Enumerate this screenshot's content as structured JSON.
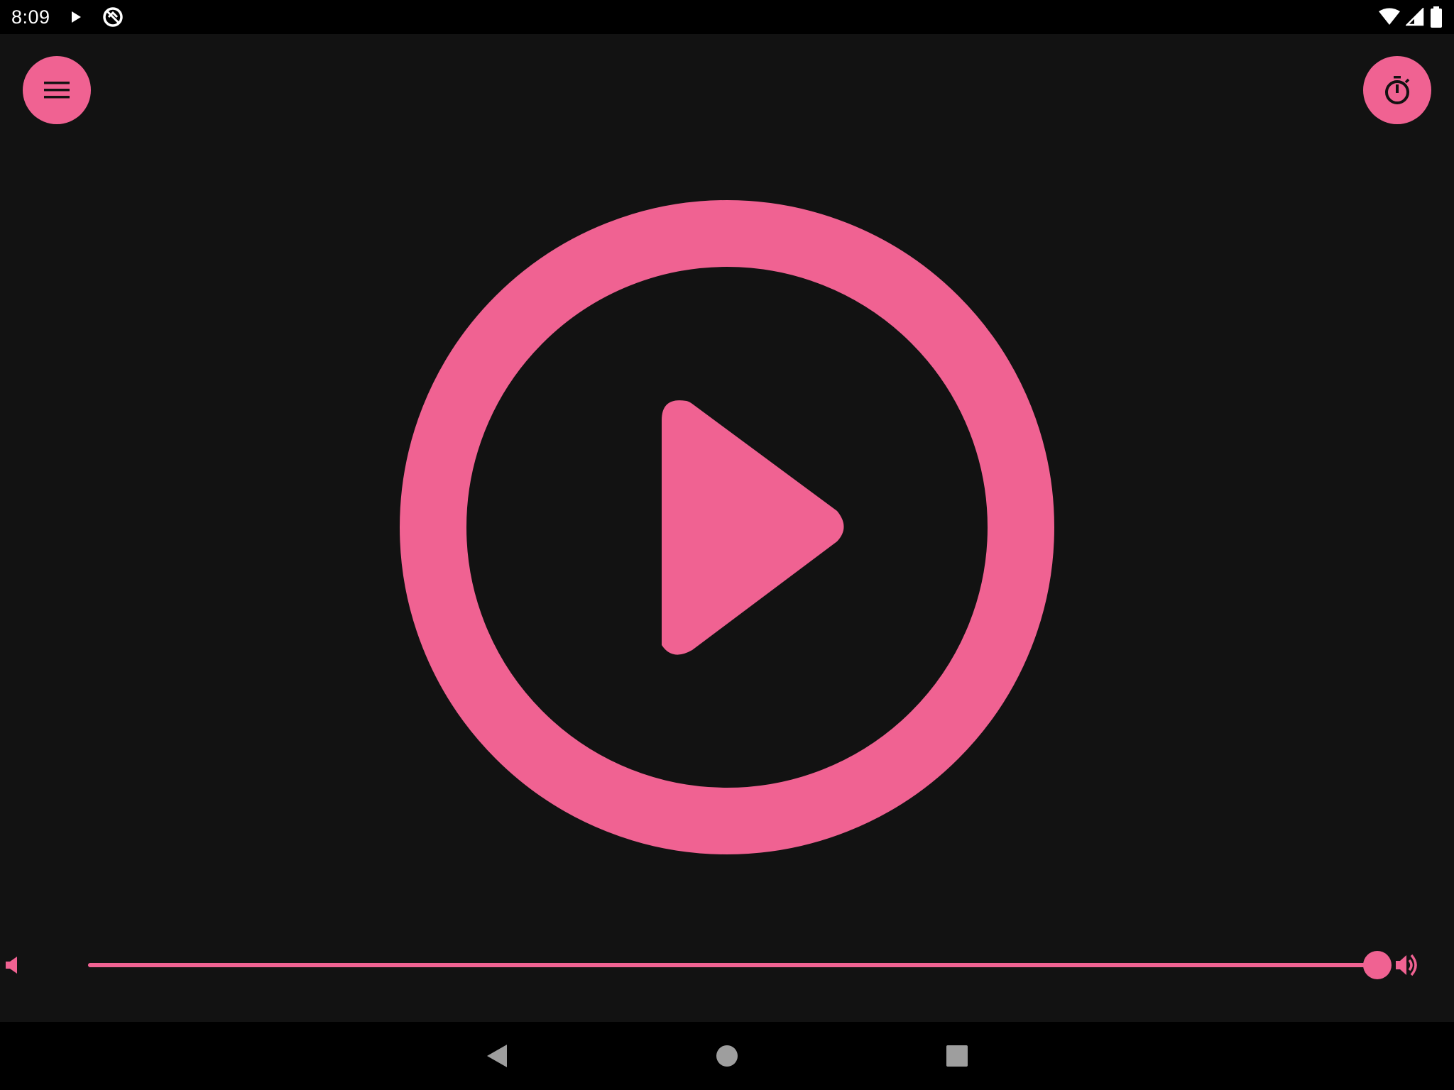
{
  "colors": {
    "accent": "#f06292",
    "background": "#121212",
    "system_bar": "#000000",
    "icon_dark": "#121212",
    "nav_icon": "#9e9e9e"
  },
  "status_bar": {
    "time": "8:09",
    "icons": [
      "play-notification-icon",
      "location-off-icon",
      "wifi-icon",
      "signal-icon",
      "battery-icon"
    ]
  },
  "toolbar": {
    "menu_icon": "menu-icon",
    "timer_icon": "timer-icon"
  },
  "player": {
    "state": "paused",
    "main_icon": "play-circle-icon"
  },
  "volume": {
    "level": 1.0,
    "low_icon": "volume-low-icon",
    "high_icon": "volume-high-icon"
  },
  "navigation": {
    "icons": [
      "back-icon",
      "home-icon",
      "recents-icon"
    ]
  }
}
